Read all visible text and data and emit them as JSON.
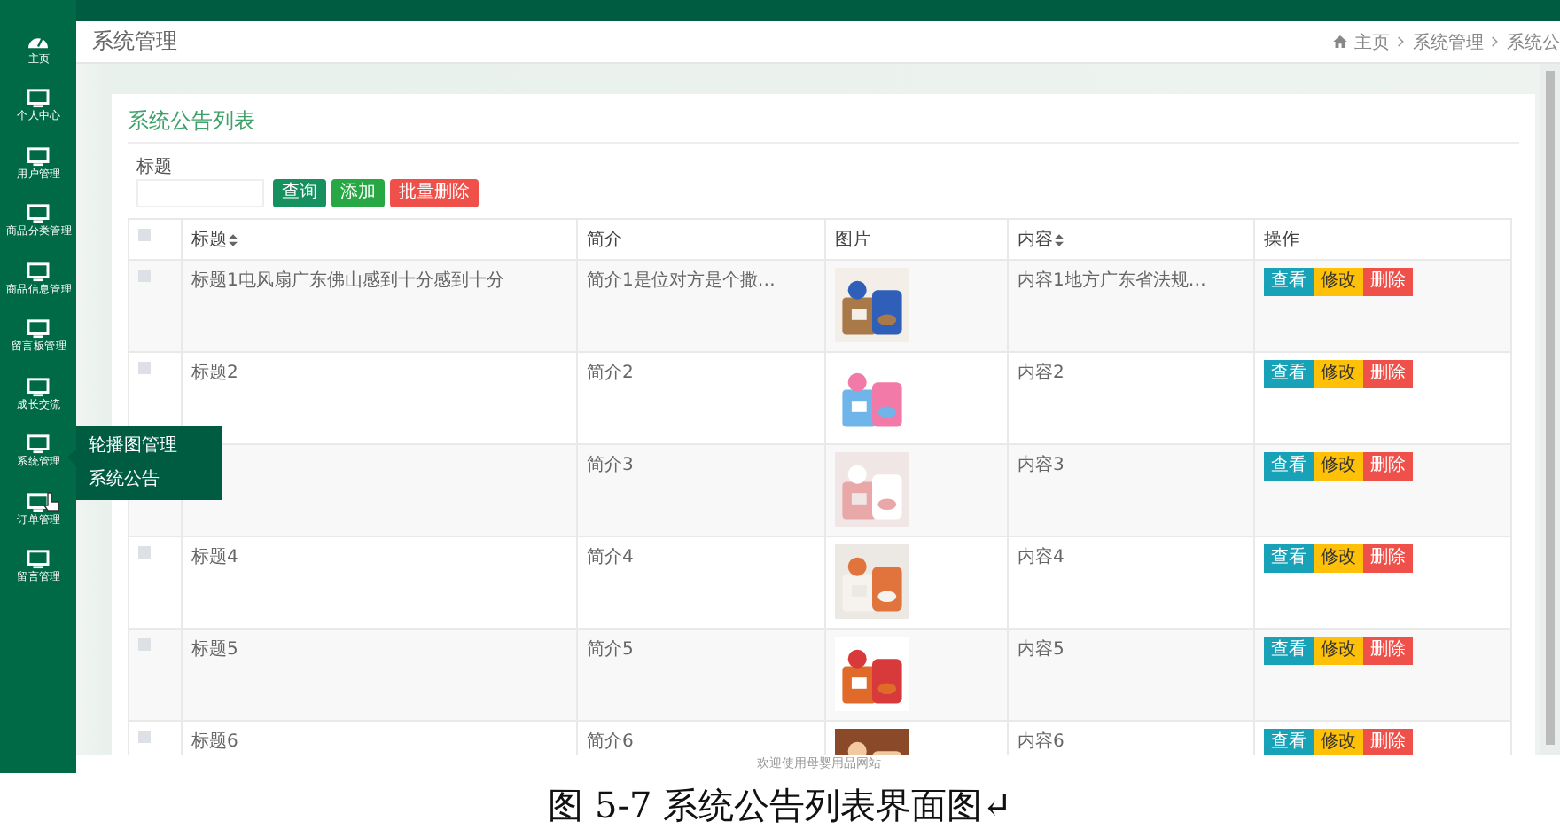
{
  "sidebar": {
    "items": [
      {
        "label": "主页"
      },
      {
        "label": "个人中心"
      },
      {
        "label": "用户管理"
      },
      {
        "label": "商品分类管理"
      },
      {
        "label": "商品信息管理"
      },
      {
        "label": "留言板管理"
      },
      {
        "label": "成长交流"
      },
      {
        "label": "系统管理"
      },
      {
        "label": "订单管理"
      },
      {
        "label": "留言管理"
      }
    ],
    "submenu": [
      "轮播图管理",
      "系统公告"
    ]
  },
  "header": {
    "title": "系统管理",
    "breadcrumb": [
      "主页",
      "系统管理",
      "系统公"
    ]
  },
  "card": {
    "title": "系统公告列表",
    "filter_label": "标题",
    "buttons": [
      {
        "label": "查询",
        "kind": "search"
      },
      {
        "label": "添加",
        "kind": "add"
      },
      {
        "label": "批量删除",
        "kind": "delete"
      }
    ]
  },
  "table": {
    "all_checked": false,
    "columns": [
      {
        "label": "标题",
        "sortable": true
      },
      {
        "label": "简介",
        "sortable": false
      },
      {
        "label": "图片",
        "sortable": false
      },
      {
        "label": "内容",
        "sortable": true
      },
      {
        "label": "操作",
        "sortable": false
      }
    ],
    "rows": [
      {
        "checked": false,
        "title": "标题1电风扇广东佛山感到十分感到十分",
        "intro": "简介1是位对方是个撒…",
        "content": "内容1地方广东省法规…",
        "actions": [
          {
            "label": "查看",
            "kind": "view"
          },
          {
            "label": "修改",
            "kind": "edit"
          },
          {
            "label": "删除",
            "kind": "delete"
          }
        ]
      },
      {
        "checked": false,
        "title": "标题2",
        "intro": "简介2",
        "content": "内容2",
        "actions": [
          {
            "label": "查看",
            "kind": "view"
          },
          {
            "label": "修改",
            "kind": "edit"
          },
          {
            "label": "删除",
            "kind": "delete"
          }
        ]
      },
      {
        "intro": "简介3",
        "content": "内容3",
        "actions": [
          {
            "label": "查看",
            "kind": "view"
          },
          {
            "label": "修改",
            "kind": "edit"
          },
          {
            "label": "删除",
            "kind": "delete"
          }
        ]
      },
      {
        "checked": false,
        "title": "标题4",
        "intro": "简介4",
        "content": "内容4",
        "actions": [
          {
            "label": "查看",
            "kind": "view"
          },
          {
            "label": "修改",
            "kind": "edit"
          },
          {
            "label": "删除",
            "kind": "delete"
          }
        ]
      },
      {
        "checked": false,
        "title": "标题5",
        "intro": "简介5",
        "content": "内容5",
        "actions": [
          {
            "label": "查看",
            "kind": "view"
          },
          {
            "label": "修改",
            "kind": "edit"
          },
          {
            "label": "删除",
            "kind": "delete"
          }
        ]
      },
      {
        "checked": false,
        "title": "标题6",
        "intro": "简介6",
        "content": "内容6",
        "actions": [
          {
            "label": "查看",
            "kind": "view"
          },
          {
            "label": "修改",
            "kind": "edit"
          },
          {
            "label": "删除",
            "kind": "delete"
          }
        ]
      }
    ]
  },
  "footer": "欢迎使用母婴用品网站",
  "caption": "图 5-7 系统公告列表界面图↵"
}
